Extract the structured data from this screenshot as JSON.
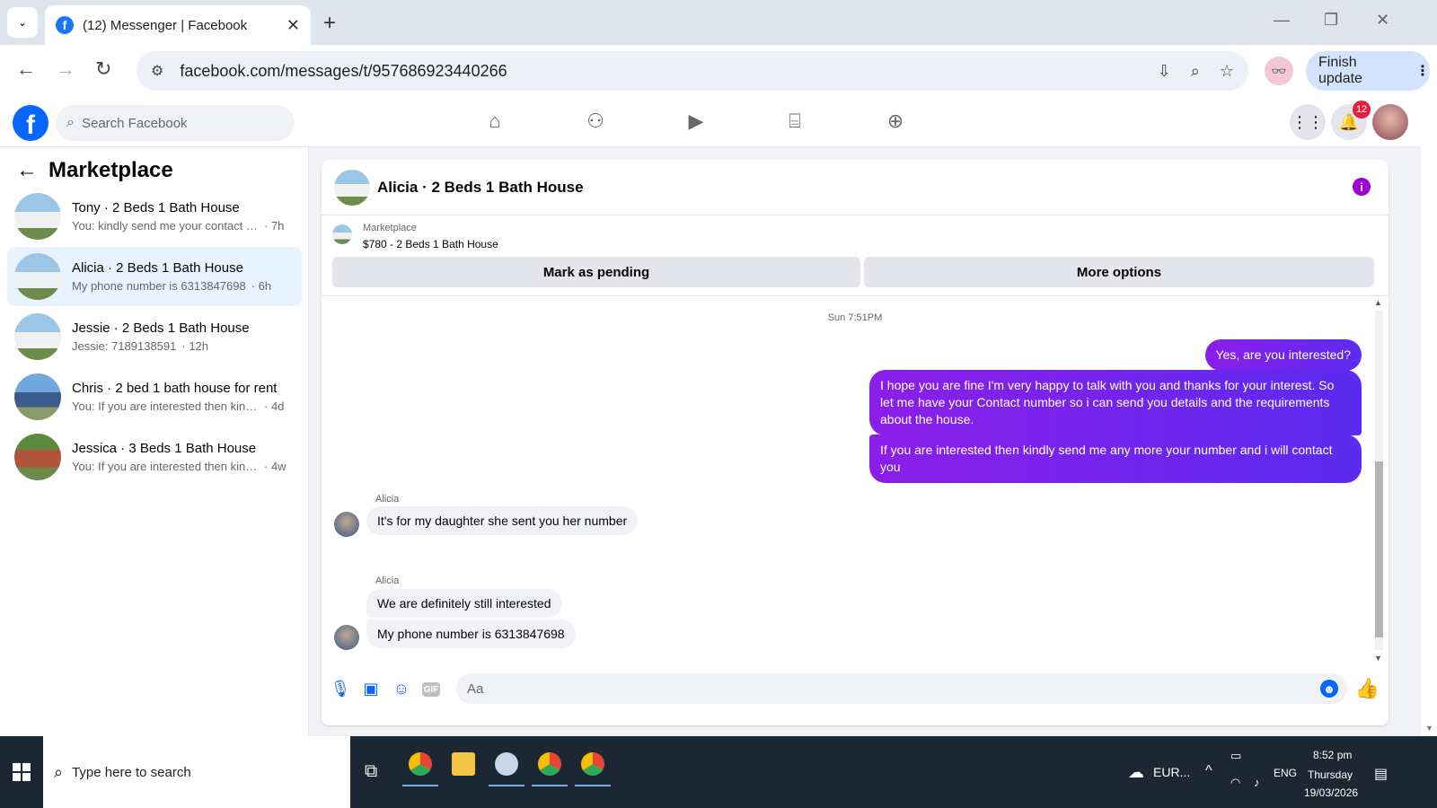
{
  "browser": {
    "tab_title": "(12) Messenger | Facebook",
    "url": "facebook.com/messages/t/957686923440266",
    "finish_update": "Finish update"
  },
  "fb": {
    "search_placeholder": "Search Facebook",
    "notification_count": "12"
  },
  "left": {
    "title": "Marketplace",
    "conversations": [
      {
        "name": "Tony · 2 Beds 1 Bath House",
        "preview": "You: kindly send me your contact nu...",
        "time": "· 7h"
      },
      {
        "name": "Alicia · 2 Beds 1 Bath House",
        "preview": "My phone number is 6313847698",
        "time": "· 6h"
      },
      {
        "name": "Jessie · 2 Beds 1 Bath House",
        "preview": "Jessie: 7189138591",
        "time": "· 12h"
      },
      {
        "name": "Chris · 2 bed 1 bath house for rent",
        "preview": "You: If you are interested then kindly s...",
        "time": "· 4d"
      },
      {
        "name": "Jessica · 3 Beds 1 Bath House",
        "preview": "You: If you are interested then kindly ...",
        "time": "· 4w"
      }
    ]
  },
  "chat": {
    "title": "Alicia · 2 Beds 1 Bath House",
    "marketplace_label": "Marketplace",
    "listing": "$780 - 2 Beds 1 Bath House",
    "mark_pending": "Mark as pending",
    "more_options": "More options",
    "timestamp": "Sun 7:51PM",
    "outgoing": [
      "Yes, are you interested?",
      "I hope you are fine I'm very happy to talk with you and thanks for your interest. So let me have your Contact number so i can send you details and the requirements about the house.",
      "If you are interested then kindly send me any more your number and i will contact you"
    ],
    "sender": "Alicia",
    "incoming": [
      "It's for my daughter she sent you her number",
      "We are definitely still interested",
      "My phone number is 6313847698"
    ],
    "composer_placeholder": "Aa"
  },
  "taskbar": {
    "search": "Type here to search",
    "weather": "EUR...",
    "lang": "ENG",
    "time": "8:52 pm",
    "day": "Thursday",
    "date": "19/03/2026"
  },
  "icons": [
    "search-icon",
    "home-icon",
    "friends-icon",
    "video-icon",
    "marketplace-icon",
    "gaming-icon",
    "menu-grid-icon",
    "bell-icon",
    "info-icon",
    "mic-icon",
    "image-icon",
    "sticker-icon",
    "gif-icon",
    "emoji-icon",
    "like-icon"
  ]
}
